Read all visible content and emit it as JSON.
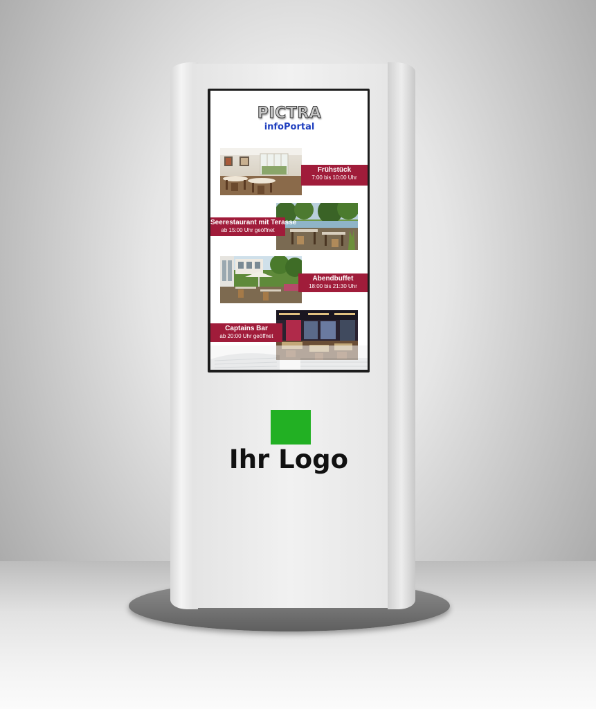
{
  "screen": {
    "brand": {
      "name": "PICTRA",
      "subtitle": "infoPortal"
    },
    "panels": [
      {
        "title": "Frühstück",
        "subtitle": "7:00 bis 10:00 Uhr"
      },
      {
        "title": "Seerestaurant mit Terasse",
        "subtitle": "ab 15:00 Uhr geöffnet"
      },
      {
        "title": "Abendbuffet",
        "subtitle": "18:00 bis 21:30 Uhr"
      },
      {
        "title": "Captains Bar",
        "subtitle": "ab 20:00 Uhr geöffnet"
      }
    ]
  },
  "logo": {
    "text": "Ihr Logo",
    "square_color": "#22b023"
  },
  "colors": {
    "label_bar": "#a01c3a",
    "brand_subtitle": "#1f3fbf"
  }
}
